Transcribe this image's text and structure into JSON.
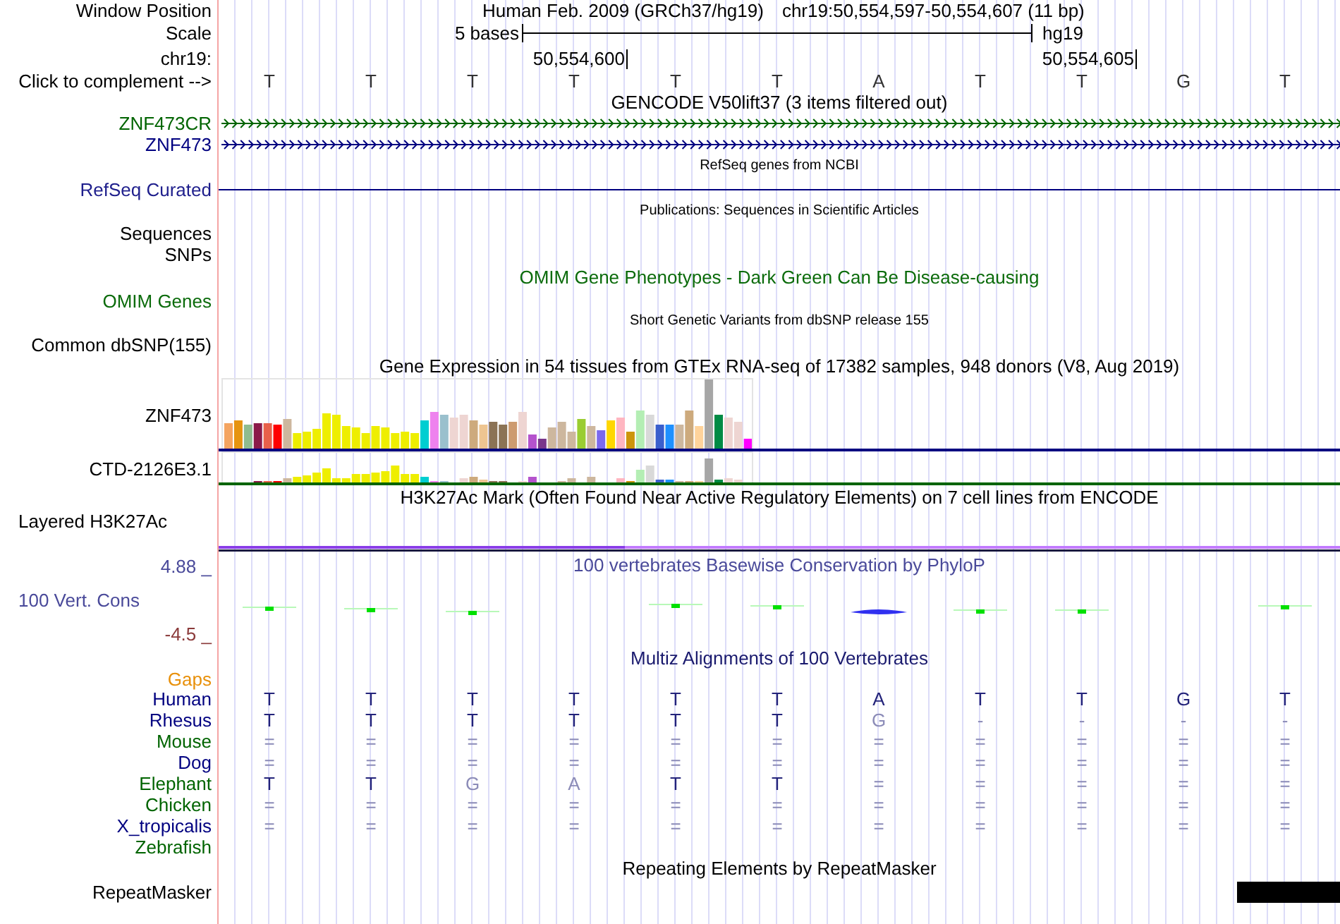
{
  "window_position": {
    "label": "Window Position",
    "assembly": "Human Feb. 2009 (GRCh37/hg19)",
    "range": "chr19:50,554,597-50,554,607 (11 bp)"
  },
  "scale": {
    "label": "Scale",
    "length": "5 bases",
    "assembly": "hg19"
  },
  "ruler": {
    "label": "chr19:",
    "ticks": [
      "50,554,600",
      "50,554,605"
    ]
  },
  "sequence": {
    "label": "Click to complement -->",
    "bases": [
      "T",
      "T",
      "T",
      "T",
      "T",
      "T",
      "A",
      "T",
      "T",
      "G",
      "T"
    ]
  },
  "gencode": {
    "title": "GENCODE V50lift37 (3 items filtered out)",
    "genes": [
      {
        "name": "ZNF473CR",
        "color": "#006400"
      },
      {
        "name": "ZNF473",
        "color": "#000080"
      }
    ]
  },
  "refseq": {
    "title": "RefSeq genes from NCBI",
    "label": "RefSeq Curated"
  },
  "publications": {
    "title": "Publications: Sequences in Scientific Articles",
    "labels": [
      "Sequences",
      "SNPs"
    ]
  },
  "omim": {
    "title": "OMIM Gene Phenotypes - Dark Green Can Be Disease-causing",
    "label": "OMIM Genes"
  },
  "dbsnp": {
    "title": "Short Genetic Variants from dbSNP release 155",
    "label": "Common dbSNP(155)"
  },
  "gtex": {
    "title": "Gene Expression in 54 tissues from GTEx RNA-seq of 17382 samples, 948 donors (V8, Aug 2019)",
    "genes": [
      {
        "name": "ZNF473",
        "color": "#000080"
      },
      {
        "name": "CTD-2126E3.1",
        "color": "#006400"
      }
    ]
  },
  "h3k27ac": {
    "title": "H3K27Ac Mark (Often Found Near Active Regulatory Elements) on 7 cell lines from ENCODE",
    "label": "Layered H3K27Ac"
  },
  "conservation": {
    "title": "100 vertebrates Basewise Conservation by PhyloP",
    "label": "100 Vert. Cons",
    "max": "4.88 _",
    "min": "-4.5 _"
  },
  "multiz": {
    "title": "Multiz Alignments of 100 Vertebrates",
    "gaps_label": "Gaps",
    "species": [
      {
        "name": "Human",
        "color": "#000080",
        "bases": [
          "T",
          "T",
          "T",
          "T",
          "T",
          "T",
          "A",
          "T",
          "T",
          "G",
          "T"
        ]
      },
      {
        "name": "Rhesus",
        "color": "#000080",
        "bases": [
          "T",
          "T",
          "T",
          "T",
          "T",
          "T",
          "G",
          "-",
          "-",
          "-",
          "-"
        ]
      },
      {
        "name": "Mouse",
        "color": "#006400",
        "bases": [
          "=",
          "=",
          "=",
          "=",
          "=",
          "=",
          "=",
          "=",
          "=",
          "=",
          "="
        ]
      },
      {
        "name": "Dog",
        "color": "#000080",
        "bases": [
          "=",
          "=",
          "=",
          "=",
          "=",
          "=",
          "=",
          "=",
          "=",
          "=",
          "="
        ]
      },
      {
        "name": "Elephant",
        "color": "#006400",
        "bases": [
          "T",
          "T",
          "G",
          "A",
          "T",
          "T",
          "=",
          "=",
          "=",
          "=",
          "="
        ]
      },
      {
        "name": "Chicken",
        "color": "#006400",
        "bases": [
          "=",
          "=",
          "=",
          "=",
          "=",
          "=",
          "=",
          "=",
          "=",
          "=",
          "="
        ]
      },
      {
        "name": "X_tropicalis",
        "color": "#000080",
        "bases": [
          "=",
          "=",
          "=",
          "=",
          "=",
          "=",
          "=",
          "=",
          "=",
          "=",
          "="
        ]
      },
      {
        "name": "Zebrafish",
        "color": "#006400"
      }
    ]
  },
  "repeatmasker": {
    "title": "Repeating Elements by RepeatMasker",
    "label": "RepeatMasker"
  }
}
